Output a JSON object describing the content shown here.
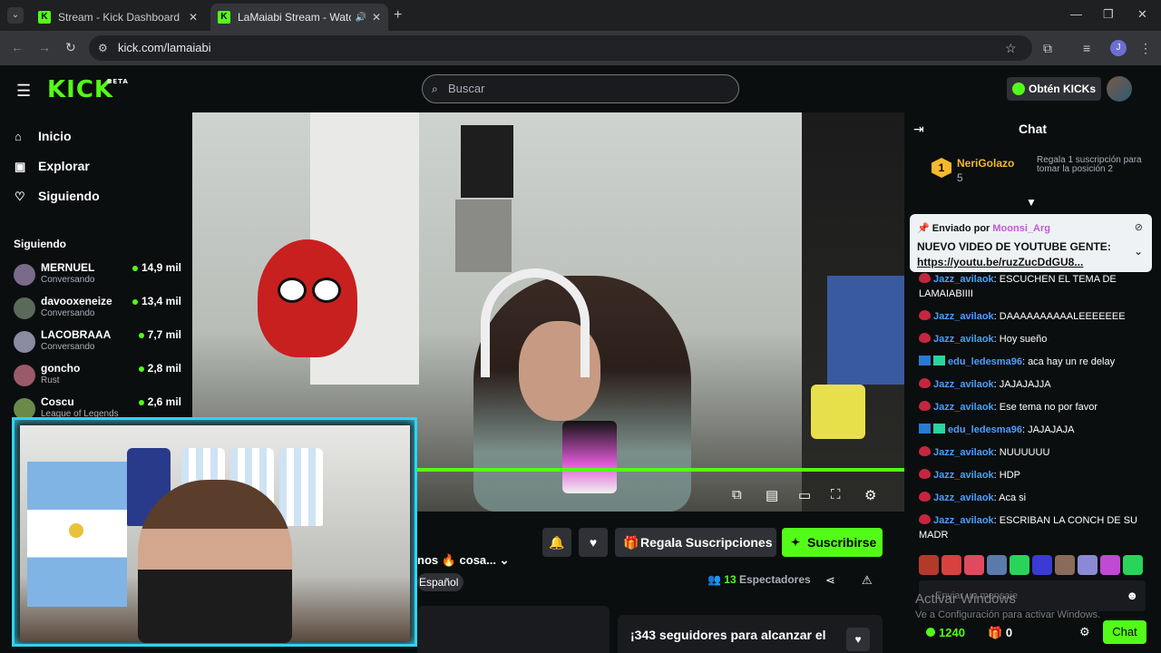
{
  "browser": {
    "tabs": [
      {
        "title": "Stream - Kick Dashboard"
      },
      {
        "title": "LaMaiabi Stream - Watch Li"
      }
    ],
    "url": "kick.com/lamaiabi",
    "profile_initial": "J"
  },
  "kick": {
    "logo": "KICK",
    "logo_badge": "BETA",
    "search_placeholder": "Buscar",
    "get_kicks": "Obtén KICKs",
    "accent": "#53fc18"
  },
  "sidebar": {
    "nav": [
      {
        "label": "Inicio",
        "icon": "home-icon"
      },
      {
        "label": "Explorar",
        "icon": "compass-icon"
      },
      {
        "label": "Siguiendo",
        "icon": "heart-icon"
      }
    ],
    "section_title": "Siguiendo",
    "following": [
      {
        "name": "MERNUEL",
        "category": "Conversando",
        "viewers": "14,9 mil"
      },
      {
        "name": "davooxeneize",
        "category": "Conversando",
        "viewers": "13,4 mil"
      },
      {
        "name": "LACOBRAAA",
        "category": "Conversando",
        "viewers": "7,7 mil"
      },
      {
        "name": "goncho",
        "category": "Rust",
        "viewers": "2,8 mil"
      },
      {
        "name": "Coscu",
        "category": "League of Legends",
        "viewers": "2,6 mil"
      }
    ]
  },
  "stream": {
    "title_fragment": "nos 🔥 cosa...",
    "tag": "Español",
    "gift_label": "Regala Suscripciones",
    "subscribe_label": "Suscribirse",
    "viewers_count": "13",
    "viewers_label": "Espectadores",
    "goal_text": "¡343 seguidores para alcanzar el"
  },
  "chat": {
    "title": "Chat",
    "leader": {
      "rank": "1",
      "name": "NeriGolazo",
      "count": "5",
      "cta": "Regala 1 suscripción para tomar la posición 2"
    },
    "pinned": {
      "sent_by": "Enviado por",
      "user": "Moonsi_Arg",
      "message": "NUEVO VIDEO DE YOUTUBE GENTE:",
      "link": "https://youtu.be/ruzZucDdGU8..."
    },
    "messages": [
      {
        "user": "Jazz_avilaok",
        "text": "ESCUCHEN EL TEMA DE LAMAIABIIII",
        "color": "#4a9eff",
        "badge": "h"
      },
      {
        "user": "Jazz_avilaok",
        "text": "DAAAAAAAAAALEEEEEEE",
        "color": "#4a9eff",
        "badge": "h"
      },
      {
        "user": "Jazz_avilaok",
        "text": "Hoy sueño",
        "color": "#4a9eff",
        "badge": "h"
      },
      {
        "user": "edu_ledesma96",
        "text": "aca hay un re delay",
        "color": "#4a9eff",
        "badge": "s"
      },
      {
        "user": "Jazz_avilaok",
        "text": "JAJAJAJJA",
        "color": "#4a9eff",
        "badge": "h"
      },
      {
        "user": "Jazz_avilaok",
        "text": "Ese tema no por favor",
        "color": "#4a9eff",
        "badge": "h"
      },
      {
        "user": "edu_ledesma96",
        "text": "JAJAJAJA",
        "color": "#4a9eff",
        "badge": "s"
      },
      {
        "user": "Jazz_avilaok",
        "text": "NUUUUUU",
        "color": "#4a9eff",
        "badge": "h"
      },
      {
        "user": "Jazz_avilaok",
        "text": "HDP",
        "color": "#4a9eff",
        "badge": "h"
      },
      {
        "user": "Jazz_avilaok",
        "text": "Aca si",
        "color": "#4a9eff",
        "badge": "h"
      },
      {
        "user": "Jazz_avilaok",
        "text": "ESCRIBAN LA CONCH DE SU MADR",
        "color": "#4a9eff",
        "badge": "h"
      }
    ],
    "input_placeholder": "Enviar un mensaje",
    "points": "1240",
    "drops": "0",
    "send_label": "Chat"
  },
  "windows_watermark": {
    "title": "Activar Windows",
    "subtitle": "Ve a Configuración para activar Windows."
  }
}
